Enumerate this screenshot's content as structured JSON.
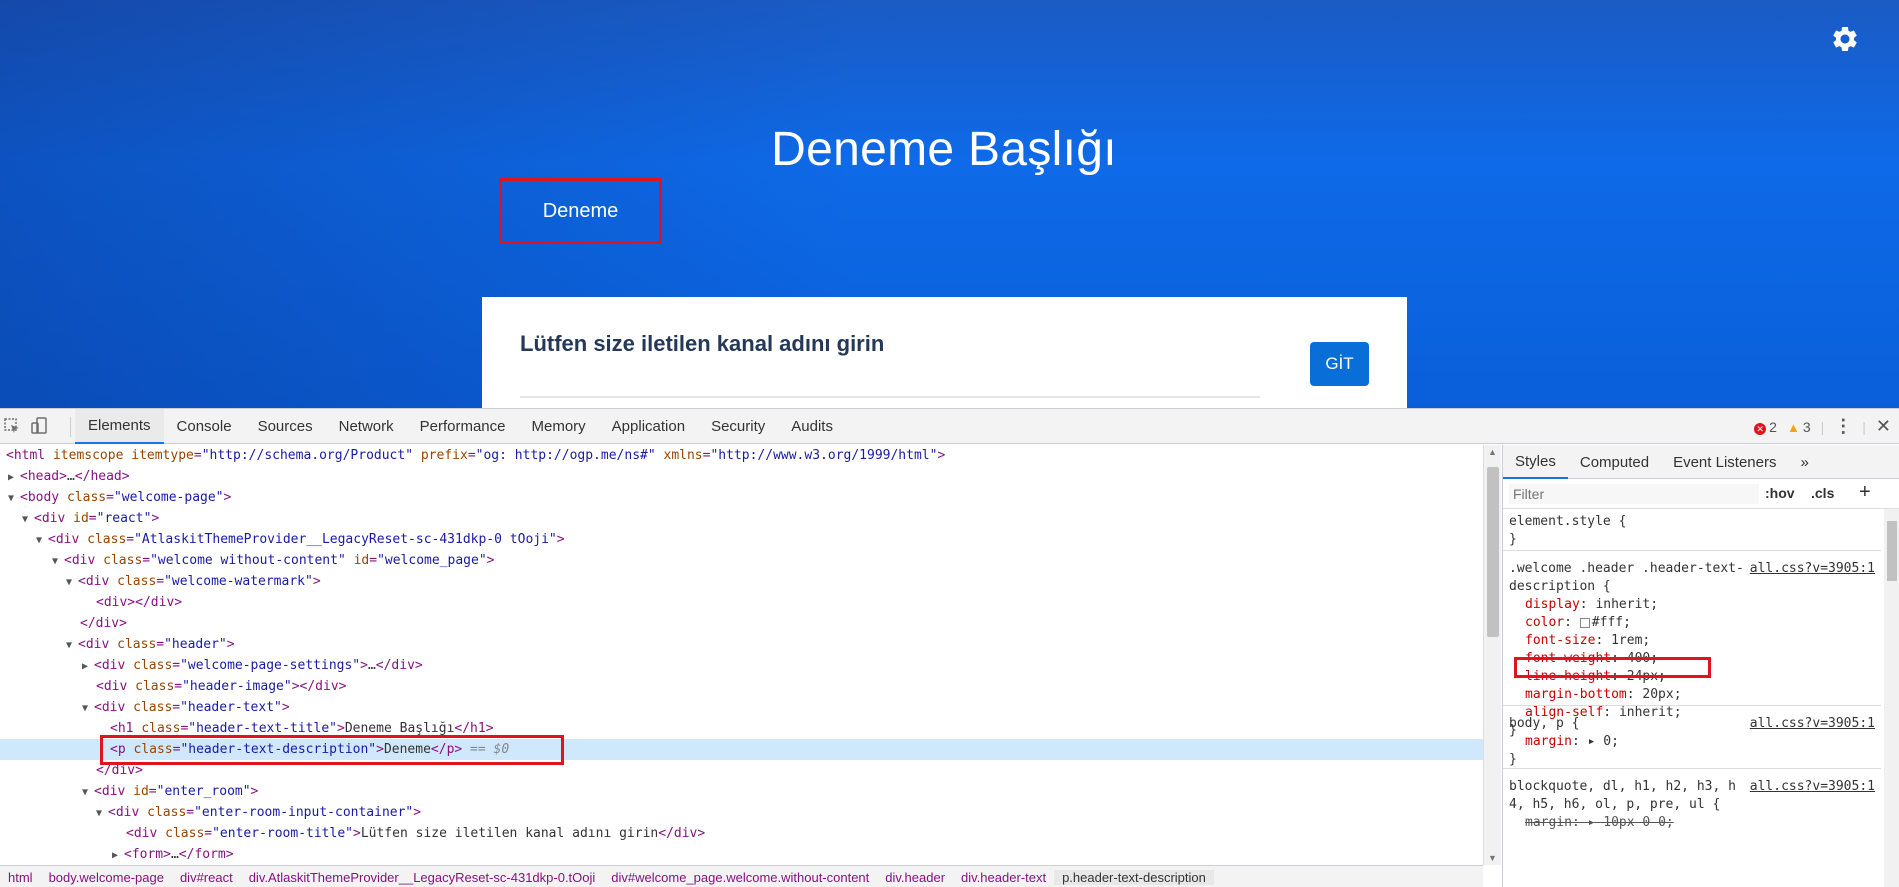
{
  "page": {
    "title": "Deneme Başlığı",
    "description": "Deneme",
    "room_title": "Lütfen size iletilen kanal adını girin",
    "go_button": "GİT",
    "settings_icon": "gear-icon"
  },
  "devtools": {
    "tabs": [
      "Elements",
      "Console",
      "Sources",
      "Network",
      "Performance",
      "Memory",
      "Application",
      "Security",
      "Audits"
    ],
    "active_tab": "Elements",
    "error_count": "2",
    "warning_count": "3",
    "dom": {
      "r0": {
        "t": "<html ",
        "a1": "itemscope ",
        "a2": "itemtype",
        "v2": "\"http://schema.org/Product\"",
        "a3": " prefix",
        "v3": "\"og: http://ogp.me/ns#\"",
        "a4": " xmlns",
        "v4": "\"http://www.w3.org/1999/html\"",
        "e": ">"
      },
      "r1": {
        "t": "<head>",
        "m": "…",
        "e": "</head>"
      },
      "r2": {
        "t": "<body ",
        "a": "class",
        "v": "\"welcome-page\"",
        "e": ">"
      },
      "r3": {
        "t": "<div ",
        "a": "id",
        "v": "\"react\"",
        "e": ">"
      },
      "r4": {
        "t": "<div ",
        "a": "class",
        "v": "\"AtlaskitThemeProvider__LegacyReset-sc-431dkp-0 tOoji\"",
        "e": ">"
      },
      "r5": {
        "t": "<div ",
        "a": "class",
        "v": "\"welcome without-content\"",
        "a2": " id",
        "v2": "\"welcome_page\"",
        "e": ">"
      },
      "r6": {
        "t": "<div ",
        "a": "class",
        "v": "\"welcome-watermark\"",
        "e": ">"
      },
      "r7": {
        "t": "<div></div>"
      },
      "r8": {
        "t": "</div>"
      },
      "r9": {
        "t": "<div ",
        "a": "class",
        "v": "\"header\"",
        "e": ">"
      },
      "r10": {
        "t": "<div ",
        "a": "class",
        "v": "\"welcome-page-settings\"",
        "e": ">",
        "m": "…",
        "c": "</div>"
      },
      "r11": {
        "t": "<div ",
        "a": "class",
        "v": "\"header-image\"",
        "e": "></div>"
      },
      "r12": {
        "t": "<div ",
        "a": "class",
        "v": "\"header-text\"",
        "e": ">"
      },
      "r13": {
        "t": "<h1 ",
        "a": "class",
        "v": "\"header-text-title\"",
        "e": ">",
        "x": "Deneme Başlığı",
        "c": "</h1>"
      },
      "r14": {
        "t": "<p ",
        "a": "class",
        "v": "\"header-text-description\"",
        "e": ">",
        "x": "Deneme",
        "c": "</p>",
        "s": " == $0"
      },
      "r15": {
        "t": "</div>"
      },
      "r16": {
        "t": "<div ",
        "a": "id",
        "v": "\"enter_room\"",
        "e": ">"
      },
      "r17": {
        "t": "<div ",
        "a": "class",
        "v": "\"enter-room-input-container\"",
        "e": ">"
      },
      "r18": {
        "t": "<div ",
        "a": "class",
        "v": "\"enter-room-title\"",
        "e": ">",
        "x": "Lütfen size iletilen kanal adını girin",
        "c": "</div>"
      },
      "r19": {
        "t": "<form>",
        "m": "…",
        "e": "</form>"
      }
    },
    "breadcrumbs": [
      "html",
      "body.welcome-page",
      "div#react",
      "div.AtlaskitThemeProvider__LegacyReset-sc-431dkp-0.tOoji",
      "div#welcome_page.welcome.without-content",
      "div.header",
      "div.header-text",
      "p.header-text-description"
    ],
    "styles": {
      "tabs": [
        "Styles",
        "Computed",
        "Event Listeners"
      ],
      "more": "»",
      "filter_placeholder": "Filter",
      "hov": ":hov",
      "cls": ".cls",
      "plus": "+",
      "element_style": "element.style {",
      "close": "}",
      "rule1_selector": ".welcome .header .header-text-description {",
      "rule1_src": "all.css?v=3905:1",
      "rule1_props": [
        {
          "n": "display",
          "v": "inherit;"
        },
        {
          "n": "color",
          "v": "#fff;"
        },
        {
          "n": "font-size",
          "v": "1rem;"
        },
        {
          "n": "font-weight",
          "v": "400;"
        },
        {
          "n": "line-height",
          "v": "24px;"
        },
        {
          "n": "margin-bottom",
          "v": "20px;"
        },
        {
          "n": "align-self",
          "v": "inherit;"
        }
      ],
      "rule2_selector": "body, p {",
      "rule2_src": "all.css?v=3905:1",
      "rule2_prop": {
        "n": "margin",
        "v": "▸ 0;"
      },
      "rule3_selector": "blockquote, dl, h1, h2, h3, h4, h5, h6, ol, p, pre, ul {",
      "rule3_src": "all.css?v=3905:1",
      "rule3_prop": {
        "n": "margin",
        "v": "▸ 10px 0 0;"
      }
    }
  },
  "colors": {
    "accent": "#0a6ed8",
    "highlight_box": "#e0141e",
    "selected_row": "#cfe8fc"
  }
}
